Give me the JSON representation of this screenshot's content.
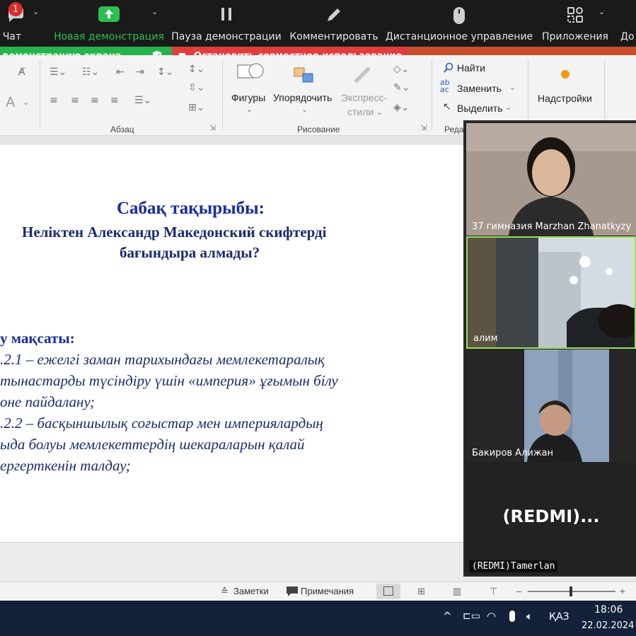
{
  "zoom_toolbar": {
    "chat_badge": "1",
    "chat_label": "Чат",
    "new_share_label": "Новая демонстрация",
    "pause_share_label": "Пауза демонстрации",
    "annotate_label": "Комментировать",
    "remote_control_label": "Дистанционное управление",
    "apps_label": "Приложения",
    "more_label": "До",
    "new_share_color": "#2dbe4e"
  },
  "share_banner": {
    "sharing_text": "демонстрацию экрана",
    "stop_text": "Остановить совместное использование",
    "green": "#27b34b",
    "red": "#e23d3d"
  },
  "ribbon": {
    "paragraph_group": "Абзац",
    "drawing_group": "Рисование",
    "editing_group_partial": "Реда",
    "shapes_label": "Фигуры",
    "arrange_label": "Упорядочить",
    "quick_styles_label1": "Экспресс-",
    "quick_styles_label2": "стили",
    "find_label": "Найти",
    "replace_label": "Заменить",
    "select_label": "Выделить",
    "addins_label": "Надстройки",
    "font_a_label": "A"
  },
  "slide": {
    "title": "Сабақ тақырыбы:",
    "subtitle_line1": "Неліктен Александр Македонский скифтерді",
    "subtitle_line2": "бағындыра алмады?",
    "goal_heading": "у мақсаты:",
    "goal_line1": ".2.1 – ежелгі заман тарихындағы мемлекетаралық",
    "goal_line2": "тынастарды түсіндіру үшін «империя» ұғымын білу",
    "goal_line3": "оне пайдалану;",
    "goal_line4": ".2.2 – басқыншылық соғыстар мен империялардың",
    "goal_line5": "ыда болуы мемлекеттердің шекараларын қалай",
    "goal_line6": "ергерткенін  талдау;"
  },
  "status_bar": {
    "notes_label": "Заметки",
    "comments_label": "Примечания",
    "zoom_minus": "–",
    "zoom_plus": "+",
    "zoom_level": 0.49
  },
  "participants": [
    {
      "name": "37 гимназия Marzhan Zhanatkyzy"
    },
    {
      "name": "алим"
    },
    {
      "name": "Бакиров Алижан"
    },
    {
      "name": "(REDMI)Tamerlan",
      "display": "(REDMI)..."
    }
  ],
  "taskbar": {
    "language": "ҚАЗ",
    "time": "18:06",
    "date": "22.02.2024"
  }
}
